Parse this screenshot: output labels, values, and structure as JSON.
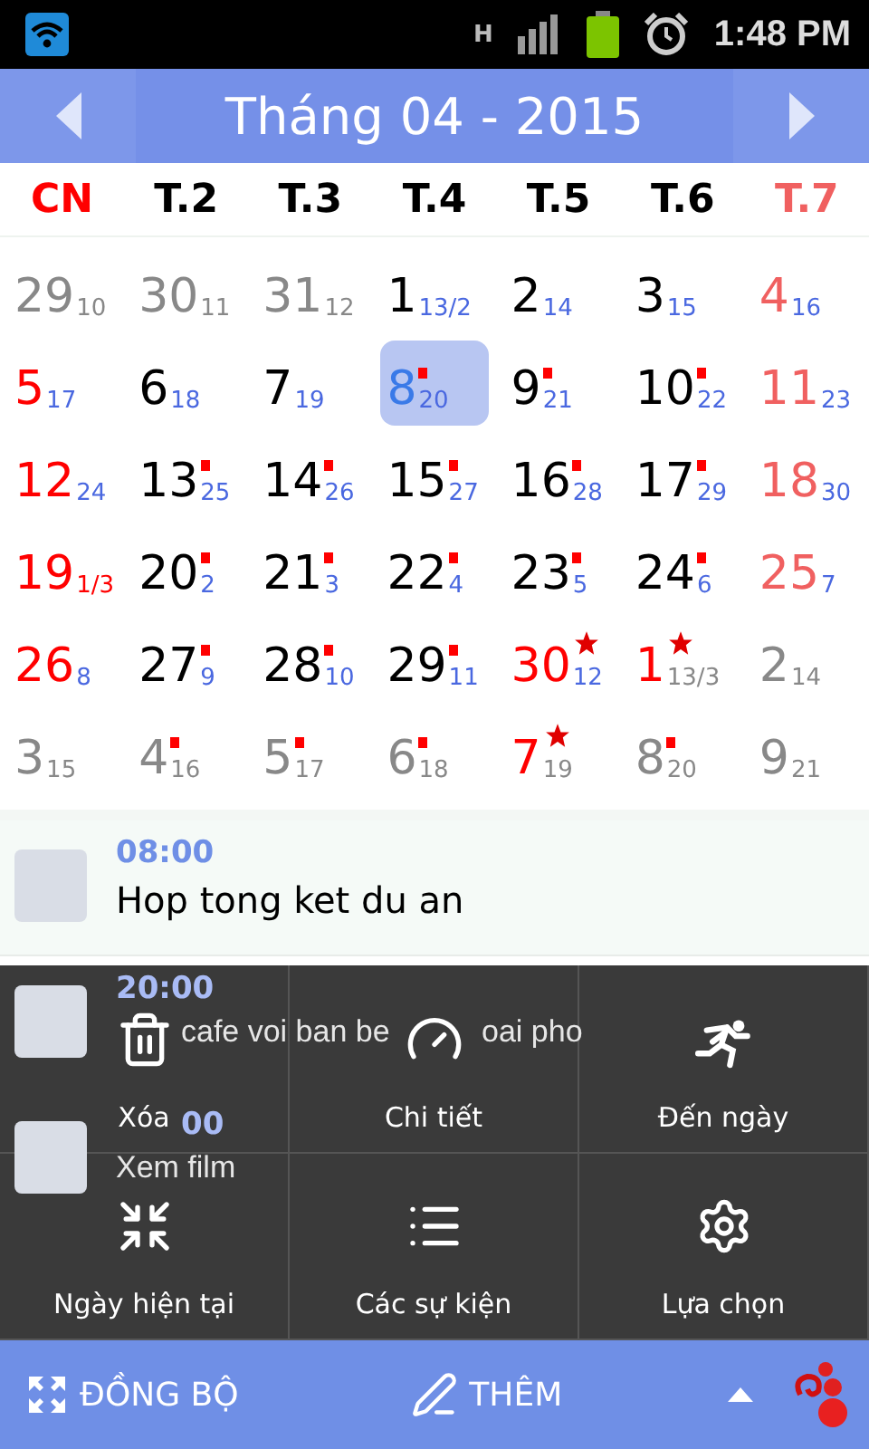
{
  "status_bar": {
    "network": "H",
    "time": "1:48 PM"
  },
  "header": {
    "title": "Tháng 04 - 2015"
  },
  "weekdays": [
    {
      "label": "CN",
      "color": "#ff0000"
    },
    {
      "label": "T.2",
      "color": "#000000"
    },
    {
      "label": "T.3",
      "color": "#000000"
    },
    {
      "label": "T.4",
      "color": "#000000"
    },
    {
      "label": "T.5",
      "color": "#000000"
    },
    {
      "label": "T.6",
      "color": "#000000"
    },
    {
      "label": "T.7",
      "color": "#f06060"
    }
  ],
  "days": [
    {
      "day": {
        "text": "29",
        "color": "#888888"
      },
      "lunar": {
        "text": "10",
        "color": "#888888"
      },
      "selected": false
    },
    {
      "day": {
        "text": "30",
        "color": "#888888"
      },
      "lunar": {
        "text": "11",
        "color": "#888888"
      },
      "selected": false
    },
    {
      "day": {
        "text": "31",
        "color": "#888888"
      },
      "lunar": {
        "text": "12",
        "color": "#888888"
      },
      "selected": false
    },
    {
      "day": {
        "text": "1",
        "color": "#000000"
      },
      "lunar": {
        "text": "13/2",
        "color": "#4a68e0"
      },
      "selected": false
    },
    {
      "day": {
        "text": "2",
        "color": "#000000"
      },
      "lunar": {
        "text": "14",
        "color": "#4a68e0"
      },
      "selected": false
    },
    {
      "day": {
        "text": "3",
        "color": "#000000"
      },
      "lunar": {
        "text": "15",
        "color": "#4a68e0"
      },
      "selected": false
    },
    {
      "day": {
        "text": "4",
        "color": "#f06060"
      },
      "lunar": {
        "text": "16",
        "color": "#4a68e0"
      },
      "selected": false
    },
    {
      "day": {
        "text": "5",
        "color": "#ff0000"
      },
      "lunar": {
        "text": "17",
        "color": "#4a68e0"
      },
      "selected": false
    },
    {
      "day": {
        "text": "6",
        "color": "#000000"
      },
      "lunar": {
        "text": "18",
        "color": "#4a68e0"
      },
      "selected": false
    },
    {
      "day": {
        "text": "7",
        "color": "#000000"
      },
      "lunar": {
        "text": "19",
        "color": "#4a68e0"
      },
      "selected": false
    },
    {
      "day": {
        "text": "8",
        "color": "#3a7ae8"
      },
      "lunar": {
        "text": "20",
        "color": "#4a68e0"
      },
      "selected": true,
      "has_event": true
    },
    {
      "day": {
        "text": "9",
        "color": "#000000"
      },
      "lunar": {
        "text": "21",
        "color": "#4a68e0"
      },
      "selected": false,
      "has_event": true
    },
    {
      "day": {
        "text": "10",
        "color": "#000000"
      },
      "lunar": {
        "text": "22",
        "color": "#4a68e0"
      },
      "selected": false,
      "has_event": true
    },
    {
      "day": {
        "text": "11",
        "color": "#f06060"
      },
      "lunar": {
        "text": "23",
        "color": "#4a68e0"
      },
      "selected": false
    },
    {
      "day": {
        "text": "12",
        "color": "#ff0000"
      },
      "lunar": {
        "text": "24",
        "color": "#4a68e0"
      },
      "selected": false
    },
    {
      "day": {
        "text": "13",
        "color": "#000000"
      },
      "lunar": {
        "text": "25",
        "color": "#4a68e0"
      },
      "selected": false,
      "has_event": true
    },
    {
      "day": {
        "text": "14",
        "color": "#000000"
      },
      "lunar": {
        "text": "26",
        "color": "#4a68e0"
      },
      "selected": false,
      "has_event": true
    },
    {
      "day": {
        "text": "15",
        "color": "#000000"
      },
      "lunar": {
        "text": "27",
        "color": "#4a68e0"
      },
      "selected": false,
      "has_event": true
    },
    {
      "day": {
        "text": "16",
        "color": "#000000"
      },
      "lunar": {
        "text": "28",
        "color": "#4a68e0"
      },
      "selected": false,
      "has_event": true
    },
    {
      "day": {
        "text": "17",
        "color": "#000000"
      },
      "lunar": {
        "text": "29",
        "color": "#4a68e0"
      },
      "selected": false,
      "has_event": true
    },
    {
      "day": {
        "text": "18",
        "color": "#f06060"
      },
      "lunar": {
        "text": "30",
        "color": "#4a68e0"
      },
      "selected": false
    },
    {
      "day": {
        "text": "19",
        "color": "#ff0000"
      },
      "lunar": {
        "text": "1/3",
        "color": "#ff0000"
      },
      "selected": false
    },
    {
      "day": {
        "text": "20",
        "color": "#000000"
      },
      "lunar": {
        "text": "2",
        "color": "#4a68e0"
      },
      "selected": false,
      "has_event": true
    },
    {
      "day": {
        "text": "21",
        "color": "#000000"
      },
      "lunar": {
        "text": "3",
        "color": "#4a68e0"
      },
      "selected": false,
      "has_event": true
    },
    {
      "day": {
        "text": "22",
        "color": "#000000"
      },
      "lunar": {
        "text": "4",
        "color": "#4a68e0"
      },
      "selected": false,
      "has_event": true
    },
    {
      "day": {
        "text": "23",
        "color": "#000000"
      },
      "lunar": {
        "text": "5",
        "color": "#4a68e0"
      },
      "selected": false,
      "has_event": true
    },
    {
      "day": {
        "text": "24",
        "color": "#000000"
      },
      "lunar": {
        "text": "6",
        "color": "#4a68e0"
      },
      "selected": false,
      "has_event": true
    },
    {
      "day": {
        "text": "25",
        "color": "#f06060"
      },
      "lunar": {
        "text": "7",
        "color": "#4a68e0"
      },
      "selected": false
    },
    {
      "day": {
        "text": "26",
        "color": "#ff0000"
      },
      "lunar": {
        "text": "8",
        "color": "#4a68e0"
      },
      "selected": false
    },
    {
      "day": {
        "text": "27",
        "color": "#000000"
      },
      "lunar": {
        "text": "9",
        "color": "#4a68e0"
      },
      "selected": false,
      "has_event": true
    },
    {
      "day": {
        "text": "28",
        "color": "#000000"
      },
      "lunar": {
        "text": "10",
        "color": "#4a68e0"
      },
      "selected": false,
      "has_event": true
    },
    {
      "day": {
        "text": "29",
        "color": "#000000"
      },
      "lunar": {
        "text": "11",
        "color": "#4a68e0"
      },
      "selected": false,
      "has_event": true
    },
    {
      "day": {
        "text": "30",
        "color": "#ff0000"
      },
      "lunar": {
        "text": "12",
        "color": "#4a68e0"
      },
      "selected": false,
      "holiday": true
    },
    {
      "day": {
        "text": "1",
        "color": "#ff0000"
      },
      "lunar": {
        "text": "13/3",
        "color": "#888888"
      },
      "selected": false,
      "holiday": true
    },
    {
      "day": {
        "text": "2",
        "color": "#888888"
      },
      "lunar": {
        "text": "14",
        "color": "#888888"
      },
      "selected": false
    },
    {
      "day": {
        "text": "3",
        "color": "#888888"
      },
      "lunar": {
        "text": "15",
        "color": "#888888"
      },
      "selected": false
    },
    {
      "day": {
        "text": "4",
        "color": "#888888"
      },
      "lunar": {
        "text": "16",
        "color": "#888888"
      },
      "selected": false,
      "has_event": true
    },
    {
      "day": {
        "text": "5",
        "color": "#888888"
      },
      "lunar": {
        "text": "17",
        "color": "#888888"
      },
      "selected": false,
      "has_event": true
    },
    {
      "day": {
        "text": "6",
        "color": "#888888"
      },
      "lunar": {
        "text": "18",
        "color": "#888888"
      },
      "selected": false,
      "has_event": true
    },
    {
      "day": {
        "text": "7",
        "color": "#ff0000"
      },
      "lunar": {
        "text": "19",
        "color": "#888888"
      },
      "selected": false,
      "holiday": true
    },
    {
      "day": {
        "text": "8",
        "color": "#888888"
      },
      "lunar": {
        "text": "20",
        "color": "#888888"
      },
      "selected": false,
      "has_event": true
    },
    {
      "day": {
        "text": "9",
        "color": "#888888"
      },
      "lunar": {
        "text": "21",
        "color": "#888888"
      },
      "selected": false
    }
  ],
  "events": [
    {
      "time": "08:00",
      "title": "Hop tong ket du an"
    },
    {
      "time": "20:00",
      "title": "cafe voi ban be",
      "title_end": "oai pho"
    },
    {
      "time": "00",
      "title": "Xem film"
    }
  ],
  "menu": [
    {
      "label": "Xóa",
      "kind": "trash"
    },
    {
      "label": "Chi tiết",
      "kind": "gauge"
    },
    {
      "label": "Đến ngày",
      "kind": "runner"
    },
    {
      "label": "Ngày hiện tại",
      "kind": "today"
    },
    {
      "label": "Các sự kiện",
      "kind": "list"
    },
    {
      "label": "Lựa chọn",
      "kind": "gear"
    }
  ],
  "bottom_bar": {
    "sync": "ĐỒNG BỘ",
    "add": "THÊM"
  }
}
